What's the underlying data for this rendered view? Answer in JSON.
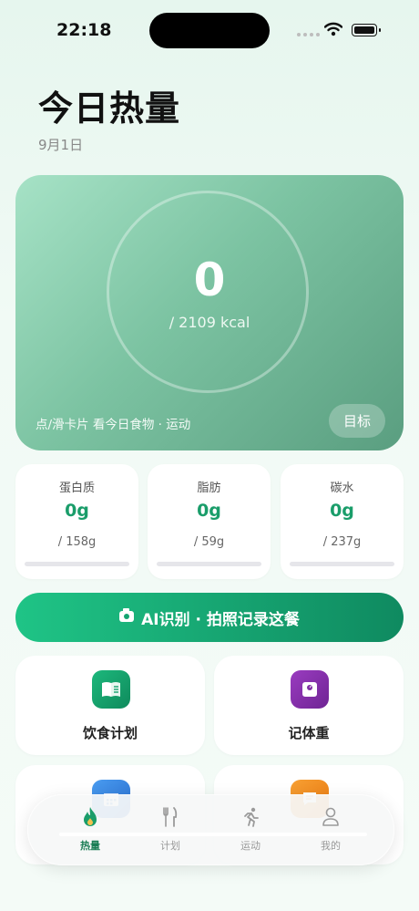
{
  "status_bar": {
    "time": "22:18"
  },
  "header": {
    "title": "今日热量",
    "date": "9月1日"
  },
  "calorie_card": {
    "consumed": "0",
    "goal_text": "/ 2109 kcal",
    "progress": 0,
    "hint": "点/滑卡片 看今日食物 · 运动",
    "goal_button": "目标"
  },
  "macros": [
    {
      "name": "蛋白质",
      "value": "0g",
      "goal": "/ 158g",
      "progress": 0
    },
    {
      "name": "脂肪",
      "value": "0g",
      "goal": "/ 59g",
      "progress": 0
    },
    {
      "name": "碳水",
      "value": "0g",
      "goal": "/ 237g",
      "progress": 0
    }
  ],
  "ai_button": {
    "label": "AI识别 · 拍照记录这餐",
    "icon": "camera-icon"
  },
  "tiles": [
    {
      "label": "饮食计划",
      "icon": "book-icon",
      "color": "#15a06c"
    },
    {
      "label": "记体重",
      "icon": "scale-icon",
      "color": "#7f2fa3"
    },
    {
      "label": "",
      "icon": "calendar-icon",
      "color": "#3a8be0"
    },
    {
      "label": "",
      "icon": "chat-icon",
      "color": "#f28a1c"
    }
  ],
  "tab_bar": {
    "active": 0,
    "items": [
      {
        "label": "热量",
        "icon": "flame-icon"
      },
      {
        "label": "计划",
        "icon": "fork-knife-icon"
      },
      {
        "label": "运动",
        "icon": "running-icon"
      },
      {
        "label": "我的",
        "icon": "person-icon"
      }
    ]
  },
  "colors": {
    "accent": "#1a9d6a",
    "accent_dark": "#0f8a60"
  }
}
